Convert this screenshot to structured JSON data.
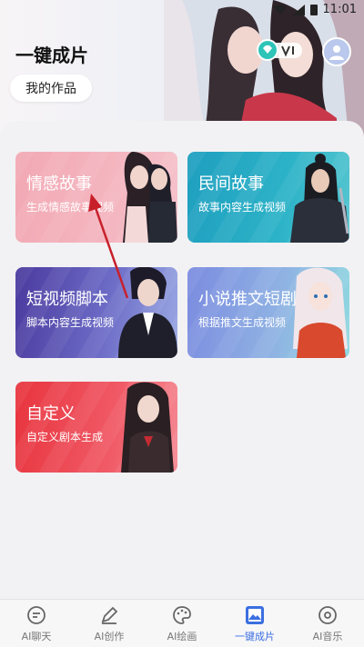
{
  "status_bar": {
    "time": "11:01"
  },
  "header": {
    "title": "一键成片",
    "my_works": "我的作品"
  },
  "cards": [
    {
      "title": "情感故事",
      "subtitle": "生成情感故事视频"
    },
    {
      "title": "民间故事",
      "subtitle": "故事内容生成视频"
    },
    {
      "title": "短视频脚本",
      "subtitle": "脚本内容生成视频"
    },
    {
      "title": "小说推文短剧",
      "subtitle": "根据推文生成视频"
    },
    {
      "title": "自定义",
      "subtitle": "自定义剧本生成"
    }
  ],
  "tabbar": {
    "items": [
      {
        "label": "AI聊天",
        "icon": "chat-icon"
      },
      {
        "label": "AI创作",
        "icon": "pen-icon"
      },
      {
        "label": "AI绘画",
        "icon": "palette-icon"
      },
      {
        "label": "一键成片",
        "icon": "film-image-icon"
      },
      {
        "label": "AI音乐",
        "icon": "disc-icon"
      }
    ],
    "active": "一键成片"
  },
  "colors": {
    "accent": "#3b6fe0",
    "card_emotion": "#f2a9b4",
    "card_folk": "#1e9fbf",
    "card_script": "#4a3a9e",
    "card_novel": "#7b8be0",
    "card_custom": "#e8343e"
  }
}
